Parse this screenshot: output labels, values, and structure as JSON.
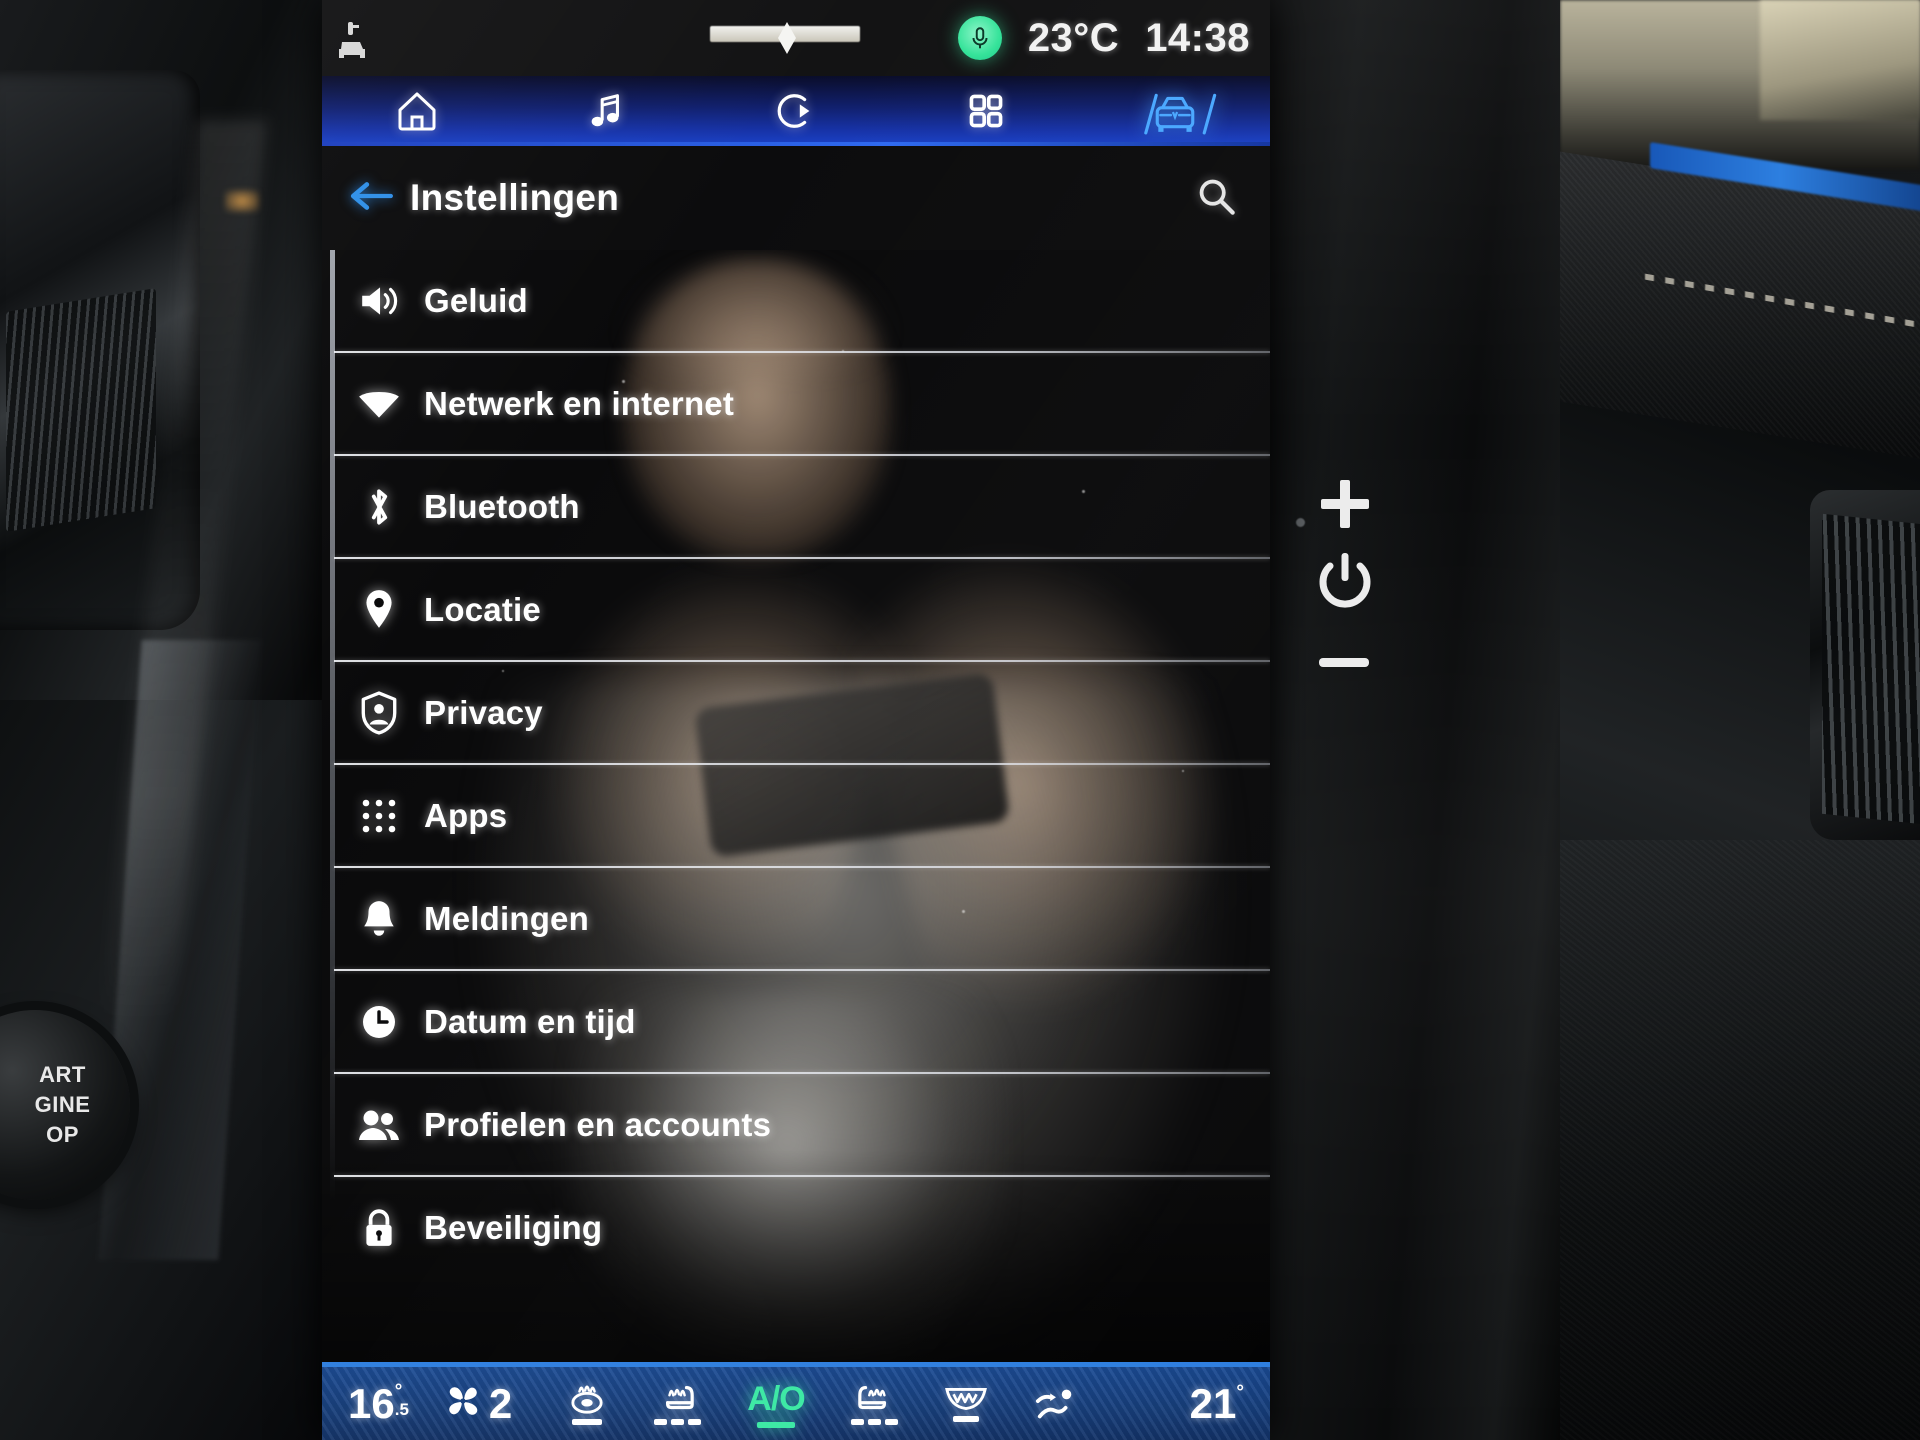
{
  "status_bar": {
    "left_icon": "car-key-icon",
    "mic_icon": "microphone-icon",
    "temperature": "23°C",
    "time": "14:38",
    "mic_color": "#35e39a"
  },
  "nav_bar": {
    "items": [
      {
        "icon": "home-icon",
        "name": "nav-home",
        "active": false
      },
      {
        "icon": "music-icon",
        "name": "nav-media",
        "active": false
      },
      {
        "icon": "play-circle-icon",
        "name": "nav-phone",
        "active": false
      },
      {
        "icon": "grid-apps-icon",
        "name": "nav-apps",
        "active": false
      },
      {
        "icon": "car-icon",
        "name": "nav-vehicle",
        "active": true
      }
    ],
    "active_color": "#4aa8ff"
  },
  "header": {
    "back_icon": "back-arrow-icon",
    "title": "Instellingen",
    "search_icon": "search-icon",
    "back_color": "#2f8fe8"
  },
  "settings_items": [
    {
      "label": "Geluid",
      "icon": "volume-icon"
    },
    {
      "label": "Netwerk en internet",
      "icon": "wifi-icon"
    },
    {
      "label": "Bluetooth",
      "icon": "bluetooth-icon"
    },
    {
      "label": "Locatie",
      "icon": "location-pin-icon"
    },
    {
      "label": "Privacy",
      "icon": "shield-person-icon"
    },
    {
      "label": "Apps",
      "icon": "apps-dots-icon"
    },
    {
      "label": "Meldingen",
      "icon": "bell-icon"
    },
    {
      "label": "Datum en tijd",
      "icon": "clock-icon"
    },
    {
      "label": "Profielen en accounts",
      "icon": "people-icon"
    },
    {
      "label": "Beveiliging",
      "icon": "lock-icon"
    }
  ],
  "climate": {
    "temp_left": "16",
    "temp_left_deg": "°",
    "temp_left_frac": ".5",
    "fan_icon": "fan-icon",
    "fan_speed": "2",
    "buttons": [
      {
        "name": "heated-windshield-icon",
        "label": "",
        "active": false
      },
      {
        "name": "heated-seat-left-icon",
        "label": "",
        "active": false
      },
      {
        "name": "auto-climate-button",
        "label": "A/O",
        "active": true
      },
      {
        "name": "heated-seat-right-icon",
        "label": "",
        "active": false
      },
      {
        "name": "rear-defrost-icon",
        "label": "",
        "active": false
      },
      {
        "name": "airflow-mode-icon",
        "label": "",
        "active": false
      }
    ],
    "temp_right": "21",
    "temp_right_deg": "°",
    "active_color": "#3ce9a4"
  },
  "hardware": {
    "start_button": "START\nENGINE\nSTOP",
    "start_line1": "ART",
    "start_line2": "GINE",
    "start_line3": "OP",
    "volume_up": "plus-button",
    "power": "power-button",
    "volume_down": "minus-button"
  }
}
